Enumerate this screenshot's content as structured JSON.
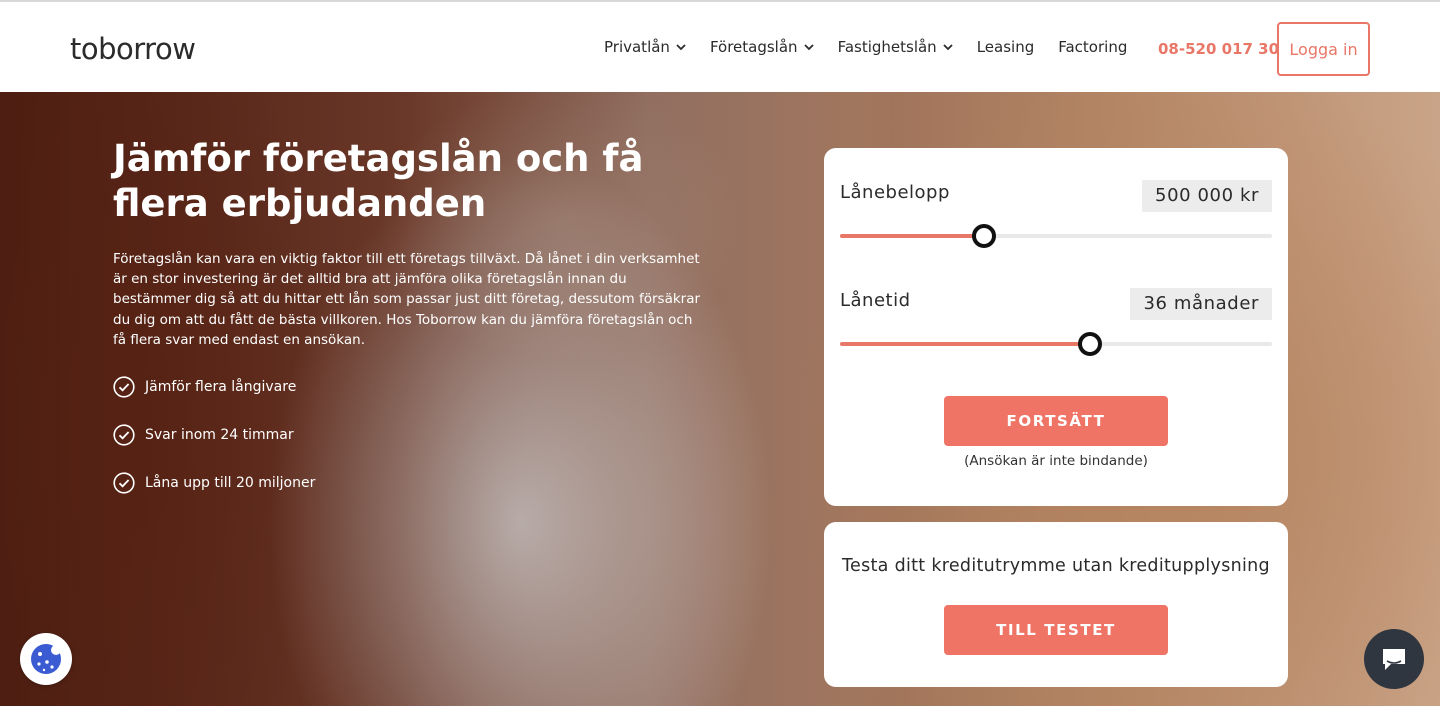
{
  "header": {
    "logo": "toborrow",
    "nav": [
      {
        "label": "Privatlån",
        "dropdown": true
      },
      {
        "label": "Företagslån",
        "dropdown": true
      },
      {
        "label": "Fastighetslån",
        "dropdown": true
      },
      {
        "label": "Leasing",
        "dropdown": false
      },
      {
        "label": "Factoring",
        "dropdown": false
      }
    ],
    "phone": "08-520 017 30",
    "login_label": "Logga in"
  },
  "hero": {
    "title": "Jämför företagslån och få flera erbjudanden",
    "text": "Företagslån kan vara en viktig faktor till ett företags tillväxt. Då lånet i din verksamhet är en stor investering är det alltid bra att jämföra olika företagslån innan du bestämmer dig så att du hittar ett lån som passar just ditt företag, dessutom försäkrar du dig om att du fått de bästa villkoren. Hos Toborrow kan du jämföra företagslån och få flera svar med endast en ansökan.",
    "bullets": [
      "Jämför flera långivare",
      "Svar inom 24 timmar",
      "Låna upp till 20 miljoner"
    ]
  },
  "calculator": {
    "amount_label": "Lånebelopp",
    "amount_value": "500 000 kr",
    "amount_slider_fraction": 0.333,
    "term_label": "Lånetid",
    "term_value": "36 månader",
    "term_slider_fraction": 0.579,
    "continue_label": "FORTSÄTT",
    "note": "(Ansökan är inte bindande)"
  },
  "credit_test": {
    "title": "Testa ditt kreditutrymme utan kreditupplysning",
    "button_label": "TILL TESTET"
  },
  "colors": {
    "accent": "#ef7465",
    "chat_bg": "#2f3640"
  },
  "icons": {
    "cookie": "cookie-icon",
    "chat": "chat-icon",
    "check": "check-circle-icon",
    "chevron": "chevron-down-icon"
  }
}
